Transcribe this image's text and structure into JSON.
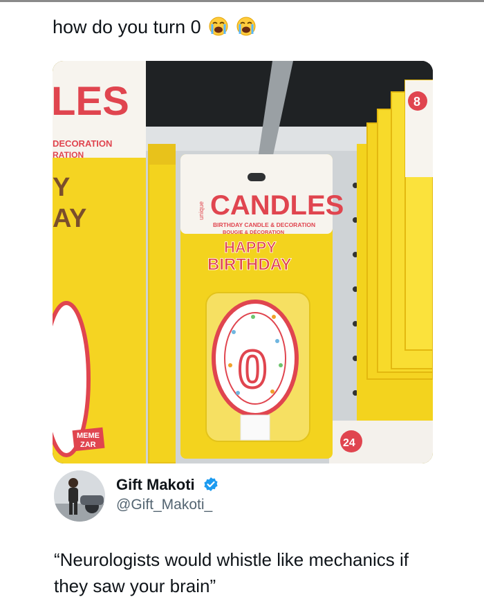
{
  "tweet": {
    "text": "how do you turn 0",
    "emoji": [
      "loudly-crying-face-emoji",
      "loudly-crying-face-emoji"
    ]
  },
  "photo": {
    "brand": "unique",
    "package_title": "CANDLES",
    "package_subtitle": "BIRTHDAY CANDLE & DECORATION",
    "package_subtitle_2": "BOUGIE & DÉCORATION",
    "happy": "HAPPY",
    "birthday": "BIRTHDAY",
    "candle_number": "0",
    "left_pkg_text_1": "LES",
    "left_pkg_text_2": "DECORATION",
    "left_pkg_text_3": "RATION",
    "left_pkg_text_4": "Y",
    "left_pkg_text_5": "AY",
    "right_pkg_number": "8",
    "bottom_pkg_number": "24",
    "watermark_line_1": "MEME",
    "watermark_line_2": "ZAR"
  },
  "author": {
    "name": "Gift Makoti",
    "handle": "@Gift_Makoti_",
    "verified": true
  },
  "quote": {
    "text": "“Neurologists would whistle like mechanics if they saw your brain”"
  },
  "colors": {
    "accent_blue": "#1d9bf0",
    "package_yellow": "#f3d31e",
    "candle_red": "#e0454f"
  }
}
